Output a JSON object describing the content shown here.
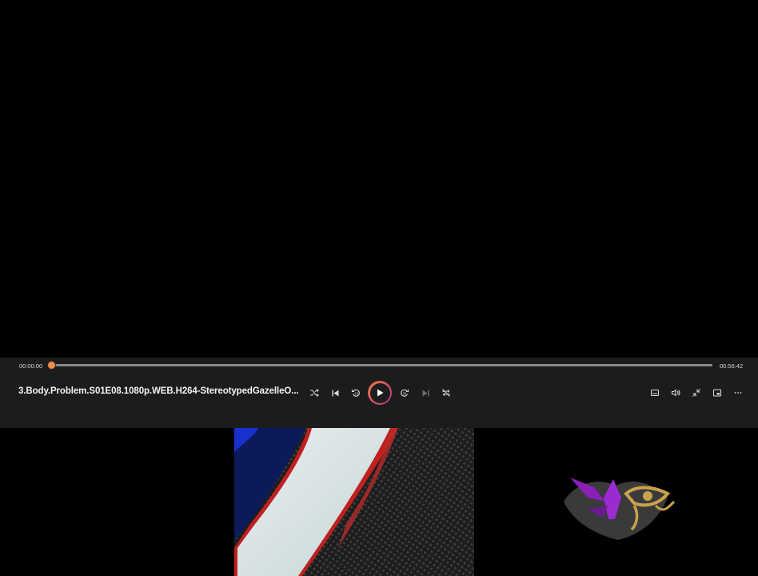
{
  "player": {
    "time_current": "00:00:00",
    "time_total": "00:56:42",
    "progress": 0,
    "title": "3.Body.Problem.S01E08.1080p.WEB.H264-StereotypedGazelleO..."
  },
  "controls": {
    "center": [
      "shuffle-icon",
      "previous-icon",
      "rewind-10-icon",
      "play-icon",
      "forward-30-icon",
      "next-icon",
      "repeat-off-icon"
    ],
    "right": [
      "subtitles-icon",
      "volume-icon",
      "exit-fullscreen-icon",
      "mini-player-icon",
      "more-icon"
    ]
  },
  "colors": {
    "accent": "#f08a4b",
    "play_ring_start": "#f07a3a",
    "play_ring_end": "#b1338e",
    "bar_bg": "#1c1c1c"
  }
}
